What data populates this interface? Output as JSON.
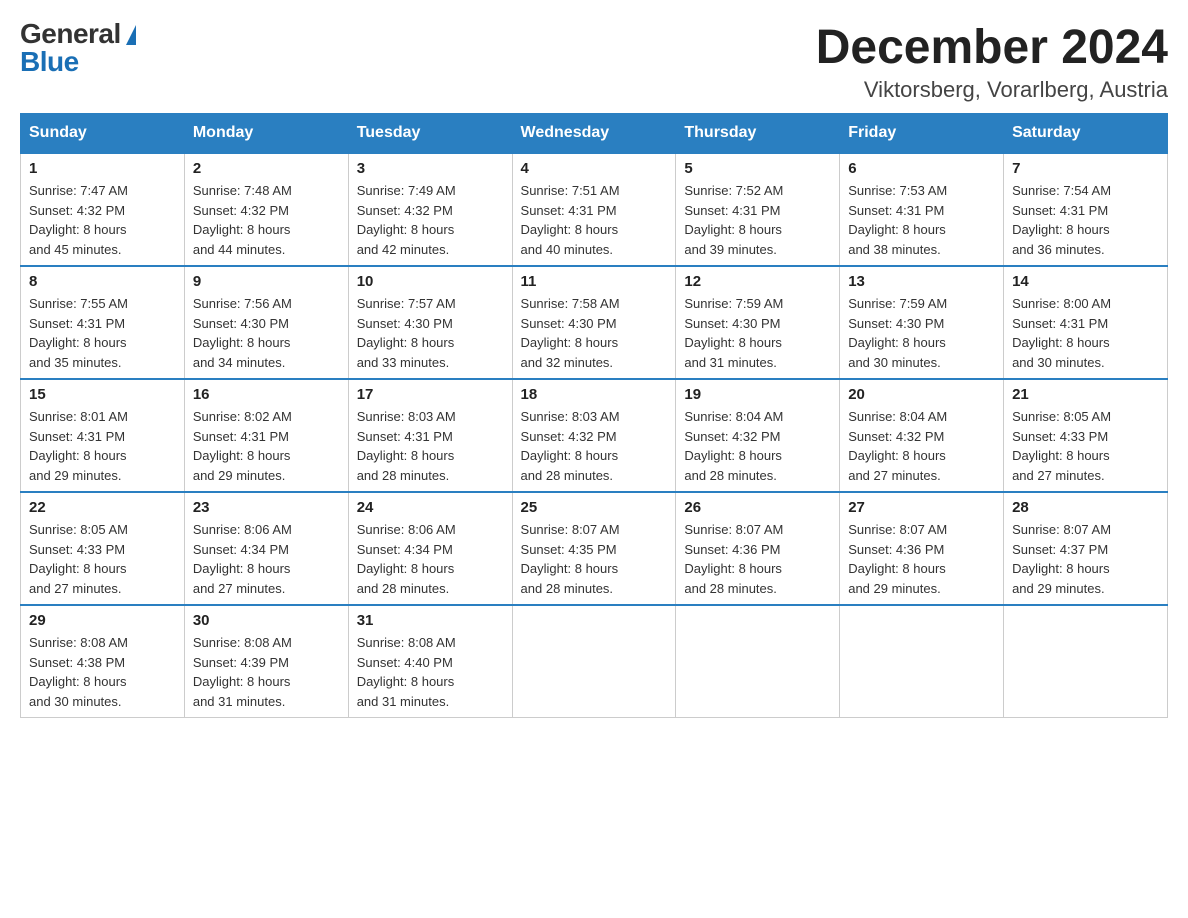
{
  "logo": {
    "general": "General",
    "blue": "Blue",
    "triangle": "▶"
  },
  "title": "December 2024",
  "location": "Viktorsberg, Vorarlberg, Austria",
  "headers": [
    "Sunday",
    "Monday",
    "Tuesday",
    "Wednesday",
    "Thursday",
    "Friday",
    "Saturday"
  ],
  "weeks": [
    [
      {
        "day": "1",
        "sunrise": "7:47 AM",
        "sunset": "4:32 PM",
        "daylight": "8 hours and 45 minutes."
      },
      {
        "day": "2",
        "sunrise": "7:48 AM",
        "sunset": "4:32 PM",
        "daylight": "8 hours and 44 minutes."
      },
      {
        "day": "3",
        "sunrise": "7:49 AM",
        "sunset": "4:32 PM",
        "daylight": "8 hours and 42 minutes."
      },
      {
        "day": "4",
        "sunrise": "7:51 AM",
        "sunset": "4:31 PM",
        "daylight": "8 hours and 40 minutes."
      },
      {
        "day": "5",
        "sunrise": "7:52 AM",
        "sunset": "4:31 PM",
        "daylight": "8 hours and 39 minutes."
      },
      {
        "day": "6",
        "sunrise": "7:53 AM",
        "sunset": "4:31 PM",
        "daylight": "8 hours and 38 minutes."
      },
      {
        "day": "7",
        "sunrise": "7:54 AM",
        "sunset": "4:31 PM",
        "daylight": "8 hours and 36 minutes."
      }
    ],
    [
      {
        "day": "8",
        "sunrise": "7:55 AM",
        "sunset": "4:31 PM",
        "daylight": "8 hours and 35 minutes."
      },
      {
        "day": "9",
        "sunrise": "7:56 AM",
        "sunset": "4:30 PM",
        "daylight": "8 hours and 34 minutes."
      },
      {
        "day": "10",
        "sunrise": "7:57 AM",
        "sunset": "4:30 PM",
        "daylight": "8 hours and 33 minutes."
      },
      {
        "day": "11",
        "sunrise": "7:58 AM",
        "sunset": "4:30 PM",
        "daylight": "8 hours and 32 minutes."
      },
      {
        "day": "12",
        "sunrise": "7:59 AM",
        "sunset": "4:30 PM",
        "daylight": "8 hours and 31 minutes."
      },
      {
        "day": "13",
        "sunrise": "7:59 AM",
        "sunset": "4:30 PM",
        "daylight": "8 hours and 30 minutes."
      },
      {
        "day": "14",
        "sunrise": "8:00 AM",
        "sunset": "4:31 PM",
        "daylight": "8 hours and 30 minutes."
      }
    ],
    [
      {
        "day": "15",
        "sunrise": "8:01 AM",
        "sunset": "4:31 PM",
        "daylight": "8 hours and 29 minutes."
      },
      {
        "day": "16",
        "sunrise": "8:02 AM",
        "sunset": "4:31 PM",
        "daylight": "8 hours and 29 minutes."
      },
      {
        "day": "17",
        "sunrise": "8:03 AM",
        "sunset": "4:31 PM",
        "daylight": "8 hours and 28 minutes."
      },
      {
        "day": "18",
        "sunrise": "8:03 AM",
        "sunset": "4:32 PM",
        "daylight": "8 hours and 28 minutes."
      },
      {
        "day": "19",
        "sunrise": "8:04 AM",
        "sunset": "4:32 PM",
        "daylight": "8 hours and 28 minutes."
      },
      {
        "day": "20",
        "sunrise": "8:04 AM",
        "sunset": "4:32 PM",
        "daylight": "8 hours and 27 minutes."
      },
      {
        "day": "21",
        "sunrise": "8:05 AM",
        "sunset": "4:33 PM",
        "daylight": "8 hours and 27 minutes."
      }
    ],
    [
      {
        "day": "22",
        "sunrise": "8:05 AM",
        "sunset": "4:33 PM",
        "daylight": "8 hours and 27 minutes."
      },
      {
        "day": "23",
        "sunrise": "8:06 AM",
        "sunset": "4:34 PM",
        "daylight": "8 hours and 27 minutes."
      },
      {
        "day": "24",
        "sunrise": "8:06 AM",
        "sunset": "4:34 PM",
        "daylight": "8 hours and 28 minutes."
      },
      {
        "day": "25",
        "sunrise": "8:07 AM",
        "sunset": "4:35 PM",
        "daylight": "8 hours and 28 minutes."
      },
      {
        "day": "26",
        "sunrise": "8:07 AM",
        "sunset": "4:36 PM",
        "daylight": "8 hours and 28 minutes."
      },
      {
        "day": "27",
        "sunrise": "8:07 AM",
        "sunset": "4:36 PM",
        "daylight": "8 hours and 29 minutes."
      },
      {
        "day": "28",
        "sunrise": "8:07 AM",
        "sunset": "4:37 PM",
        "daylight": "8 hours and 29 minutes."
      }
    ],
    [
      {
        "day": "29",
        "sunrise": "8:08 AM",
        "sunset": "4:38 PM",
        "daylight": "8 hours and 30 minutes."
      },
      {
        "day": "30",
        "sunrise": "8:08 AM",
        "sunset": "4:39 PM",
        "daylight": "8 hours and 31 minutes."
      },
      {
        "day": "31",
        "sunrise": "8:08 AM",
        "sunset": "4:40 PM",
        "daylight": "8 hours and 31 minutes."
      },
      null,
      null,
      null,
      null
    ]
  ],
  "labels": {
    "sunrise": "Sunrise:",
    "sunset": "Sunset:",
    "daylight": "Daylight:"
  }
}
